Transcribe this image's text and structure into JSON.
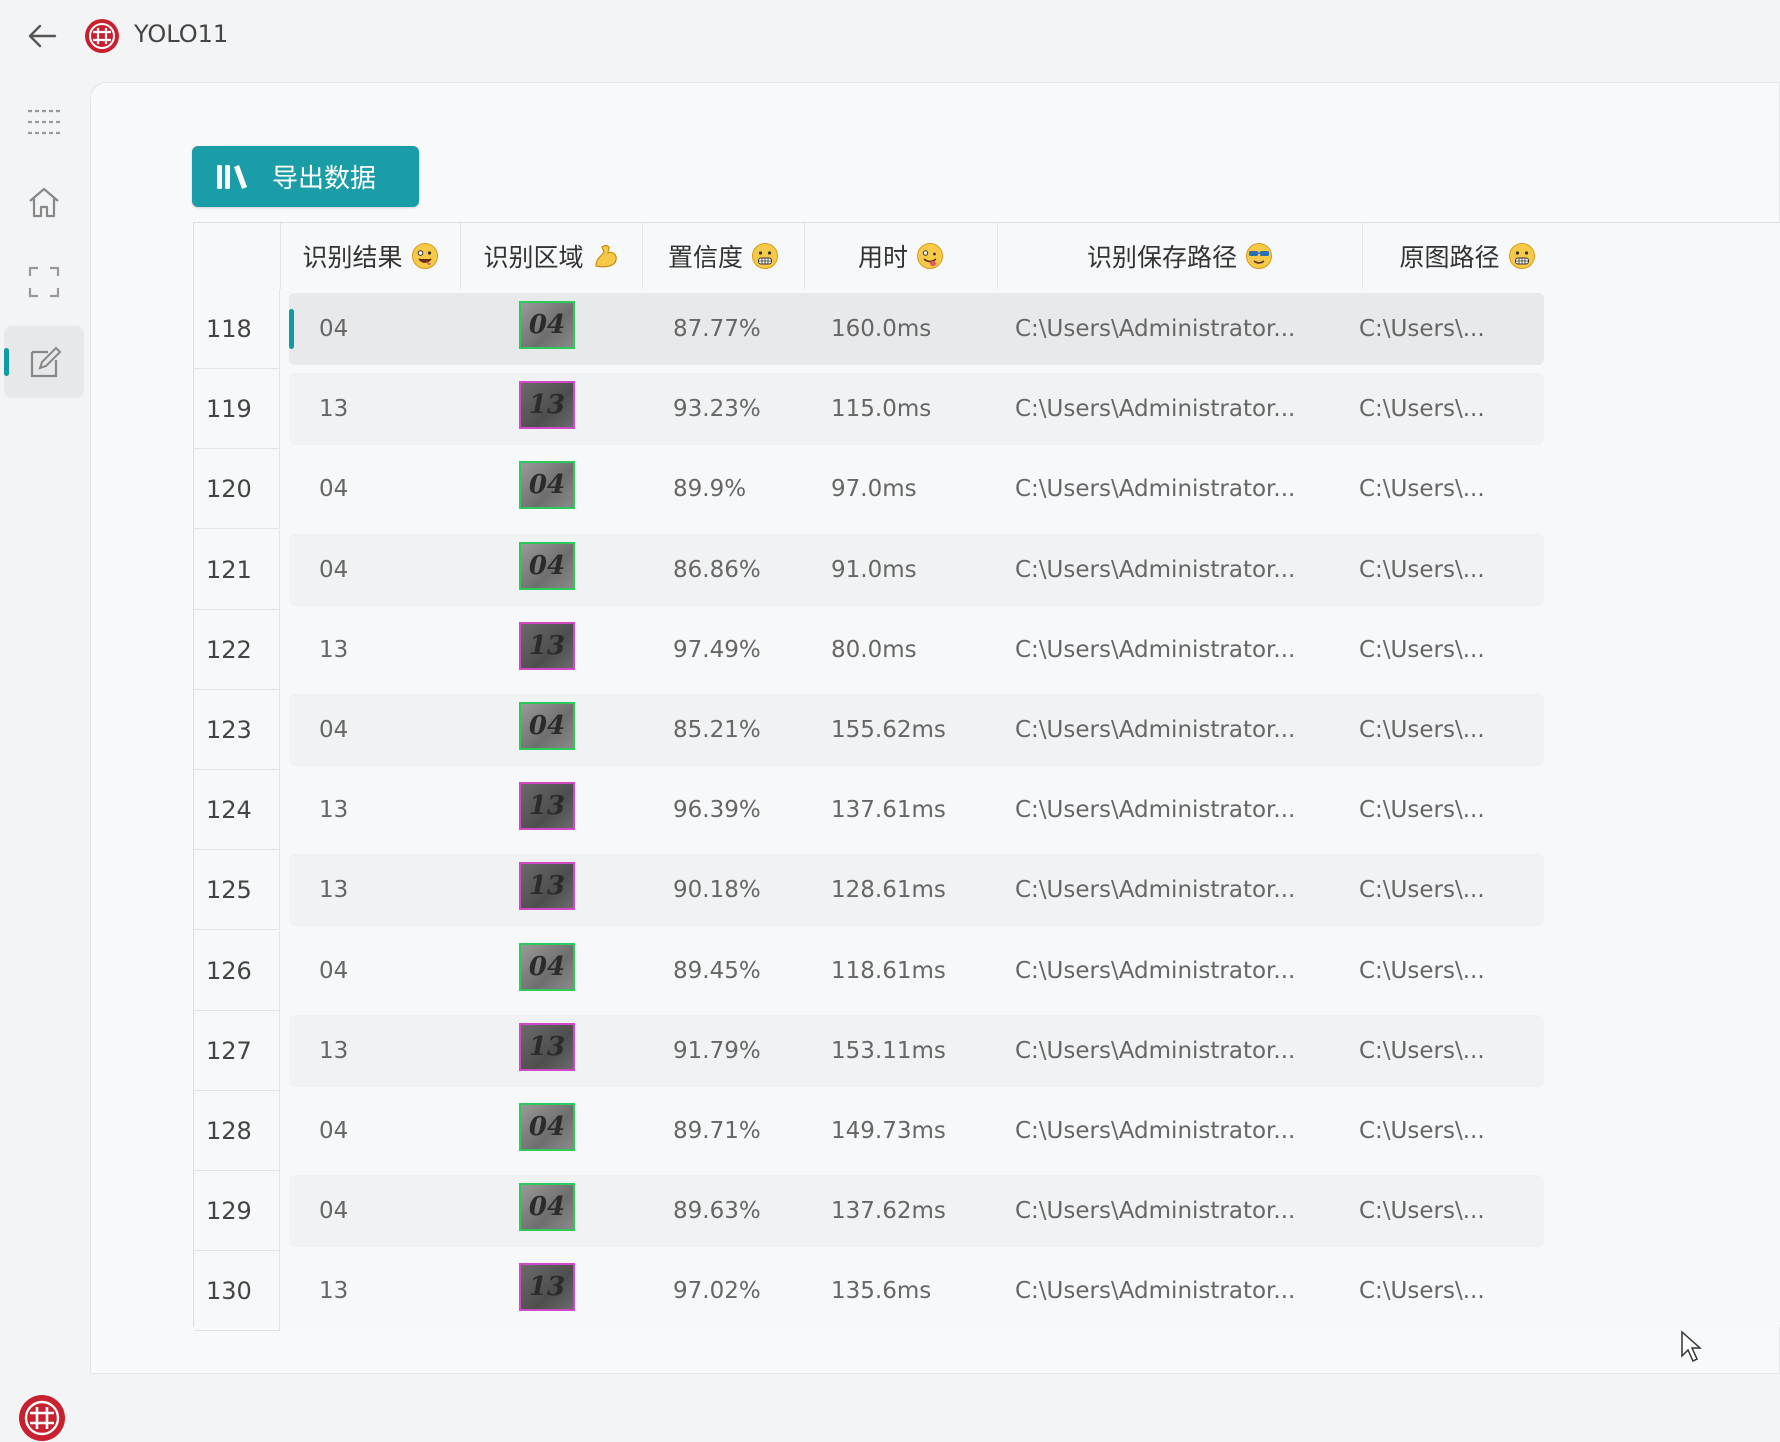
{
  "window": {
    "title": "YOLO11"
  },
  "export_button": {
    "label": "导出数据",
    "icon": "library-icon"
  },
  "table": {
    "columns": [
      {
        "label": "识别结果",
        "emoji": "crazy-face"
      },
      {
        "label": "识别区域",
        "emoji": "flexed-biceps"
      },
      {
        "label": "置信度",
        "emoji": "grimacing-face"
      },
      {
        "label": "用时",
        "emoji": "zany-face"
      },
      {
        "label": "识别保存路径",
        "emoji": "cool-face"
      },
      {
        "label": "原图路径",
        "emoji": "grimacing-face"
      }
    ],
    "rows": [
      {
        "index": "118",
        "result": "04",
        "confidence": "87.77%",
        "time": "160.0ms",
        "save_path": "C:\\Users\\Administrator...",
        "orig_path": "C:\\Users\\..."
      },
      {
        "index": "119",
        "result": "13",
        "confidence": "93.23%",
        "time": "115.0ms",
        "save_path": "C:\\Users\\Administrator...",
        "orig_path": "C:\\Users\\..."
      },
      {
        "index": "120",
        "result": "04",
        "confidence": "89.9%",
        "time": "97.0ms",
        "save_path": "C:\\Users\\Administrator...",
        "orig_path": "C:\\Users\\..."
      },
      {
        "index": "121",
        "result": "04",
        "confidence": "86.86%",
        "time": "91.0ms",
        "save_path": "C:\\Users\\Administrator...",
        "orig_path": "C:\\Users\\..."
      },
      {
        "index": "122",
        "result": "13",
        "confidence": "97.49%",
        "time": "80.0ms",
        "save_path": "C:\\Users\\Administrator...",
        "orig_path": "C:\\Users\\..."
      },
      {
        "index": "123",
        "result": "04",
        "confidence": "85.21%",
        "time": "155.62ms",
        "save_path": "C:\\Users\\Administrator...",
        "orig_path": "C:\\Users\\..."
      },
      {
        "index": "124",
        "result": "13",
        "confidence": "96.39%",
        "time": "137.61ms",
        "save_path": "C:\\Users\\Administrator...",
        "orig_path": "C:\\Users\\..."
      },
      {
        "index": "125",
        "result": "13",
        "confidence": "90.18%",
        "time": "128.61ms",
        "save_path": "C:\\Users\\Administrator...",
        "orig_path": "C:\\Users\\..."
      },
      {
        "index": "126",
        "result": "04",
        "confidence": "89.45%",
        "time": "118.61ms",
        "save_path": "C:\\Users\\Administrator...",
        "orig_path": "C:\\Users\\..."
      },
      {
        "index": "127",
        "result": "13",
        "confidence": "91.79%",
        "time": "153.11ms",
        "save_path": "C:\\Users\\Administrator...",
        "orig_path": "C:\\Users\\..."
      },
      {
        "index": "128",
        "result": "04",
        "confidence": "89.71%",
        "time": "149.73ms",
        "save_path": "C:\\Users\\Administrator...",
        "orig_path": "C:\\Users\\..."
      },
      {
        "index": "129",
        "result": "04",
        "confidence": "89.63%",
        "time": "137.62ms",
        "save_path": "C:\\Users\\Administrator...",
        "orig_path": "C:\\Users\\..."
      },
      {
        "index": "130",
        "result": "13",
        "confidence": "97.02%",
        "time": "135.6ms",
        "save_path": "C:\\Users\\Administrator...",
        "orig_path": "C:\\Users\\..."
      }
    ]
  },
  "colors": {
    "accent": "#1a9da6",
    "thumb_border_04": "#2ec95a",
    "thumb_border_13": "#d04ac8",
    "logo_red": "#c8202f"
  }
}
